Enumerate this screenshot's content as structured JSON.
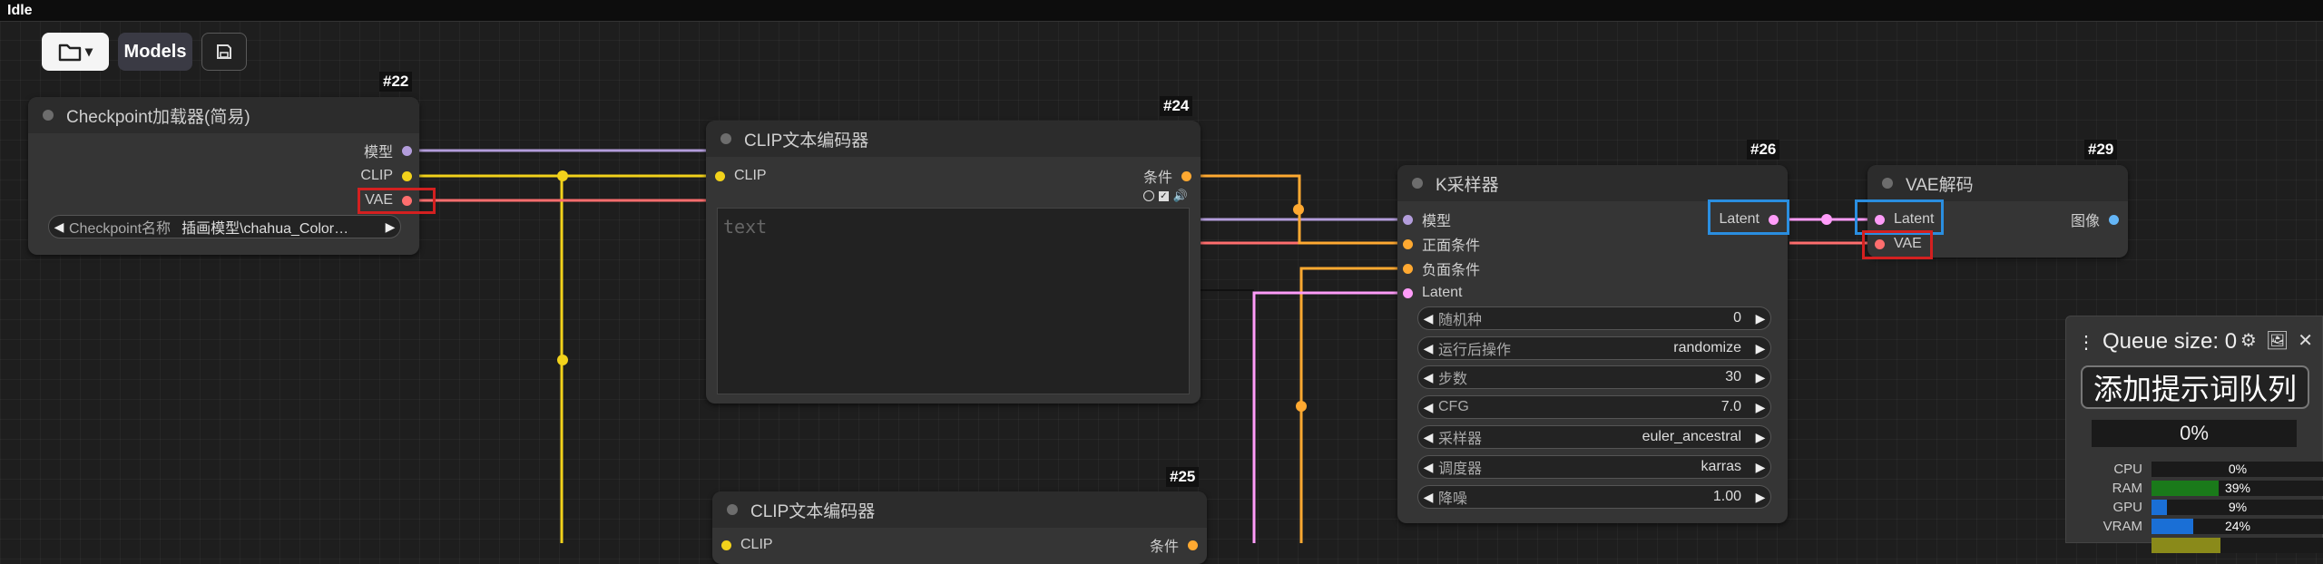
{
  "app": {
    "status": "Idle"
  },
  "toolbar": {
    "folder_label": "▾",
    "models_label": "Models"
  },
  "nodes": {
    "checkpoint": {
      "id": "#22",
      "title": "Checkpoint加载器(简易)",
      "outputs": [
        "模型",
        "CLIP",
        "VAE"
      ],
      "widget": {
        "label": "Checkpoint名称",
        "value": "插画模型\\chahua_Color…"
      }
    },
    "clip_pos": {
      "id": "#24",
      "title": "CLIP文本编码器",
      "input": "CLIP",
      "output": "条件",
      "placeholder": "text"
    },
    "clip_neg": {
      "id": "#25",
      "title": "CLIP文本编码器",
      "input": "CLIP",
      "output": "条件"
    },
    "ksampler": {
      "id": "#26",
      "title": "K采样器",
      "inputs": [
        "模型",
        "正面条件",
        "负面条件",
        "Latent"
      ],
      "output": "Latent",
      "widgets": [
        {
          "label": "随机种",
          "value": "0"
        },
        {
          "label": "运行后操作",
          "value": "randomize"
        },
        {
          "label": "步数",
          "value": "30"
        },
        {
          "label": "CFG",
          "value": "7.0"
        },
        {
          "label": "采样器",
          "value": "euler_ancestral"
        },
        {
          "label": "调度器",
          "value": "karras"
        },
        {
          "label": "降噪",
          "value": "1.00"
        }
      ]
    },
    "vae_decode": {
      "id": "#29",
      "title": "VAE解码",
      "inputs": [
        "Latent",
        "VAE"
      ],
      "output": "图像"
    }
  },
  "queue": {
    "title": "Queue size: 0",
    "button": "添加提示词队列",
    "progress": "0%",
    "stats": [
      {
        "name": "CPU",
        "value": "0%",
        "percent": 0,
        "color": "#1a7a1a"
      },
      {
        "name": "RAM",
        "value": "39%",
        "percent": 39,
        "color": "#1a7a1a"
      },
      {
        "name": "GPU",
        "value": "9%",
        "percent": 9,
        "color": "#1a6fd6"
      },
      {
        "name": "VRAM",
        "value": "24%",
        "percent": 24,
        "color": "#1a6fd6"
      }
    ]
  },
  "colors": {
    "model": "#b39ddb",
    "clip": "#f2d21b",
    "vae": "#ff6e6e",
    "conditioning": "#ffa931",
    "latent": "#ff9cf9",
    "image": "#64b5f6",
    "highlight_blue": "#2a8ee0",
    "highlight_red": "#d42020"
  }
}
